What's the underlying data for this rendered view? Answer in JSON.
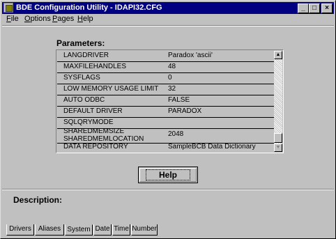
{
  "window": {
    "title": "BDE Configuration Utility - IDAPI32.CFG",
    "min_glyph": "_",
    "max_glyph": "□",
    "close_glyph": "×"
  },
  "menubar": {
    "items": [
      {
        "key": "F",
        "rest": "ile"
      },
      {
        "key": "O",
        "rest": "ptions"
      },
      {
        "key": "P",
        "rest": "ages"
      },
      {
        "key": "H",
        "rest": "elp"
      }
    ]
  },
  "parameters": {
    "label": "Parameters:",
    "rows": [
      {
        "name": "LANGDRIVER",
        "value": "Paradox 'ascii'"
      },
      {
        "name": "MAXFILEHANDLES",
        "value": "48"
      },
      {
        "name": "SYSFLAGS",
        "value": "0"
      },
      {
        "name": "LOW MEMORY USAGE LIMIT",
        "value": "32"
      },
      {
        "name": "AUTO ODBC",
        "value": "FALSE"
      },
      {
        "name": "DEFAULT DRIVER",
        "value": "PARADOX"
      },
      {
        "name": "SQLQRYMODE",
        "value": ""
      },
      {
        "name": "SHAREDMEMSIZE",
        "name2": "SHAREDMEMLOCATION",
        "value": "2048"
      },
      {
        "name": "DATA REPOSITORY",
        "value": "SampleBCB Data Dictionary"
      }
    ],
    "scroll_up_glyph": "▲",
    "scroll_down_glyph": "▼"
  },
  "help_button": {
    "label": "Help"
  },
  "description": {
    "label": "Description:"
  },
  "tabs": [
    {
      "label": "Drivers",
      "underline_index": 0,
      "active": false
    },
    {
      "label": "Aliases",
      "underline_index": 0,
      "active": false
    },
    {
      "label": "System",
      "underline_index": 0,
      "active": true
    },
    {
      "label": "Date",
      "underline_index": 0,
      "active": false
    },
    {
      "label": "Time",
      "underline_index": 0,
      "active": false
    },
    {
      "label": "Number",
      "underline_index": 0,
      "active": false
    }
  ]
}
